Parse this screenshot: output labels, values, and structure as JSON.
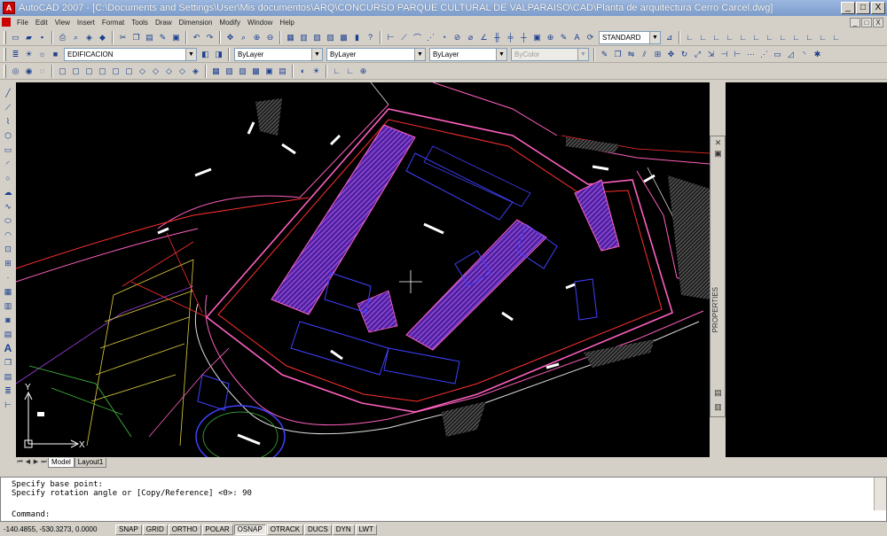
{
  "window": {
    "title": "AutoCAD 2007 - [C:\\Documents and Settings\\User\\Mis documentos\\ARQ\\CONCURSO PARQUE CULTURAL DE VALPARAISO\\CAD\\Planta de arquitectura Cerro Carcel.dwg]",
    "minimize": "_",
    "maximize": "□",
    "close": "X"
  },
  "menu": {
    "items": [
      "File",
      "Edit",
      "View",
      "Insert",
      "Format",
      "Tools",
      "Draw",
      "Dimension",
      "Modify",
      "Window",
      "Help"
    ]
  },
  "toolbars": {
    "text_style": "STANDARD",
    "layer": "EDIFICACION",
    "color": "ByLayer",
    "linetype": "ByLayer",
    "lineweight": "ByLayer",
    "plot_style": "ByColor"
  },
  "palette": {
    "label": "PROPERTIES"
  },
  "tabs": [
    "Model",
    "Layout1"
  ],
  "command": {
    "history": [
      "Specify base point:",
      "Specify rotation angle or [Copy/Reference] <0>: 90"
    ],
    "prompt": "Command:"
  },
  "status": {
    "coordinates": "-140.4855, -530.3273, 0.0000",
    "toggles": [
      {
        "label": "SNAP",
        "on": false
      },
      {
        "label": "GRID",
        "on": false
      },
      {
        "label": "ORTHO",
        "on": false
      },
      {
        "label": "POLAR",
        "on": false
      },
      {
        "label": "OSNAP",
        "on": true
      },
      {
        "label": "OTRACK",
        "on": false
      },
      {
        "label": "DUCS",
        "on": false
      },
      {
        "label": "DYN",
        "on": false
      },
      {
        "label": "LWT",
        "on": false
      }
    ]
  },
  "ucs": {
    "x_label": "X",
    "y_label": "Y"
  },
  "colors": {
    "canvas": "#000000",
    "purple": "#a040e0",
    "magenta": "#ff60c0",
    "blue": "#4040ff",
    "red": "#ff3030",
    "yellow": "#e0d040",
    "green": "#40c040"
  }
}
